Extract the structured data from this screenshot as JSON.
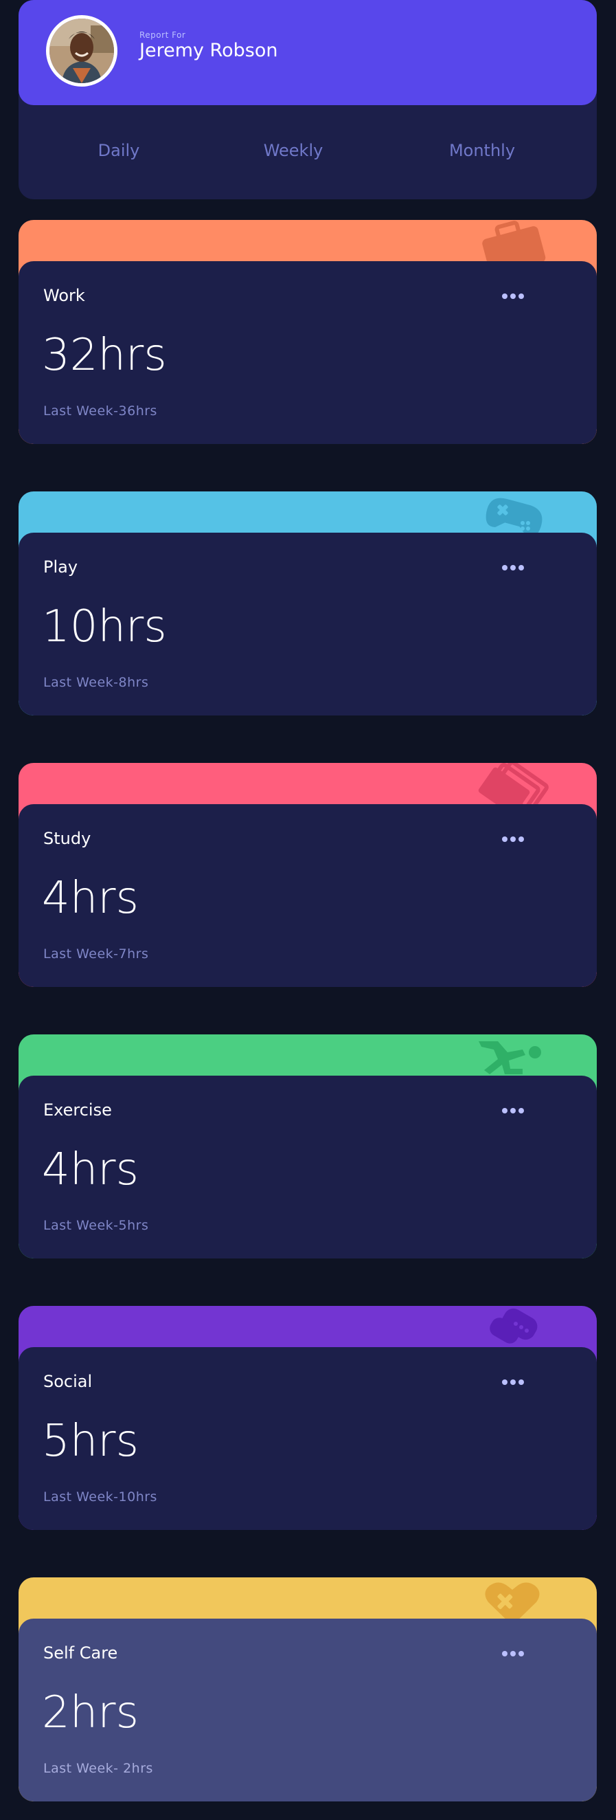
{
  "profile": {
    "report_for": "Report For",
    "name": "Jeremy Robson",
    "periods": [
      {
        "label": "Daily"
      },
      {
        "label": "Weekly"
      },
      {
        "label": "Monthly"
      }
    ]
  },
  "cards": [
    {
      "title": "Work",
      "current": "32hrs",
      "previous": "Last Week-36hrs",
      "color": "#ff8b64",
      "icon": "briefcase-icon"
    },
    {
      "title": "Play",
      "current": "10hrs",
      "previous": "Last Week-8hrs",
      "color": "#55c2e6",
      "icon": "gamepad-icon"
    },
    {
      "title": "Study",
      "current": "4hrs",
      "previous": "Last Week-7hrs",
      "color": "#ff5e7d",
      "icon": "book-icon"
    },
    {
      "title": "Exercise",
      "current": "4hrs",
      "previous": "Last Week-5hrs",
      "color": "#4bcf82",
      "icon": "runner-icon"
    },
    {
      "title": "Social",
      "current": "5hrs",
      "previous": "Last Week-10hrs",
      "color": "#7335d2",
      "icon": "chat-icon"
    },
    {
      "title": "Self Care",
      "current": "2hrs",
      "previous": "Last Week- 2hrs",
      "color": "#f1c75b",
      "icon": "heart-icon"
    }
  ],
  "colors": {
    "background": "#0e1323",
    "card": "#1c1f4a",
    "card_hover": "#434a7e",
    "accent": "#5847eb",
    "muted_text": "#7f86c7"
  }
}
